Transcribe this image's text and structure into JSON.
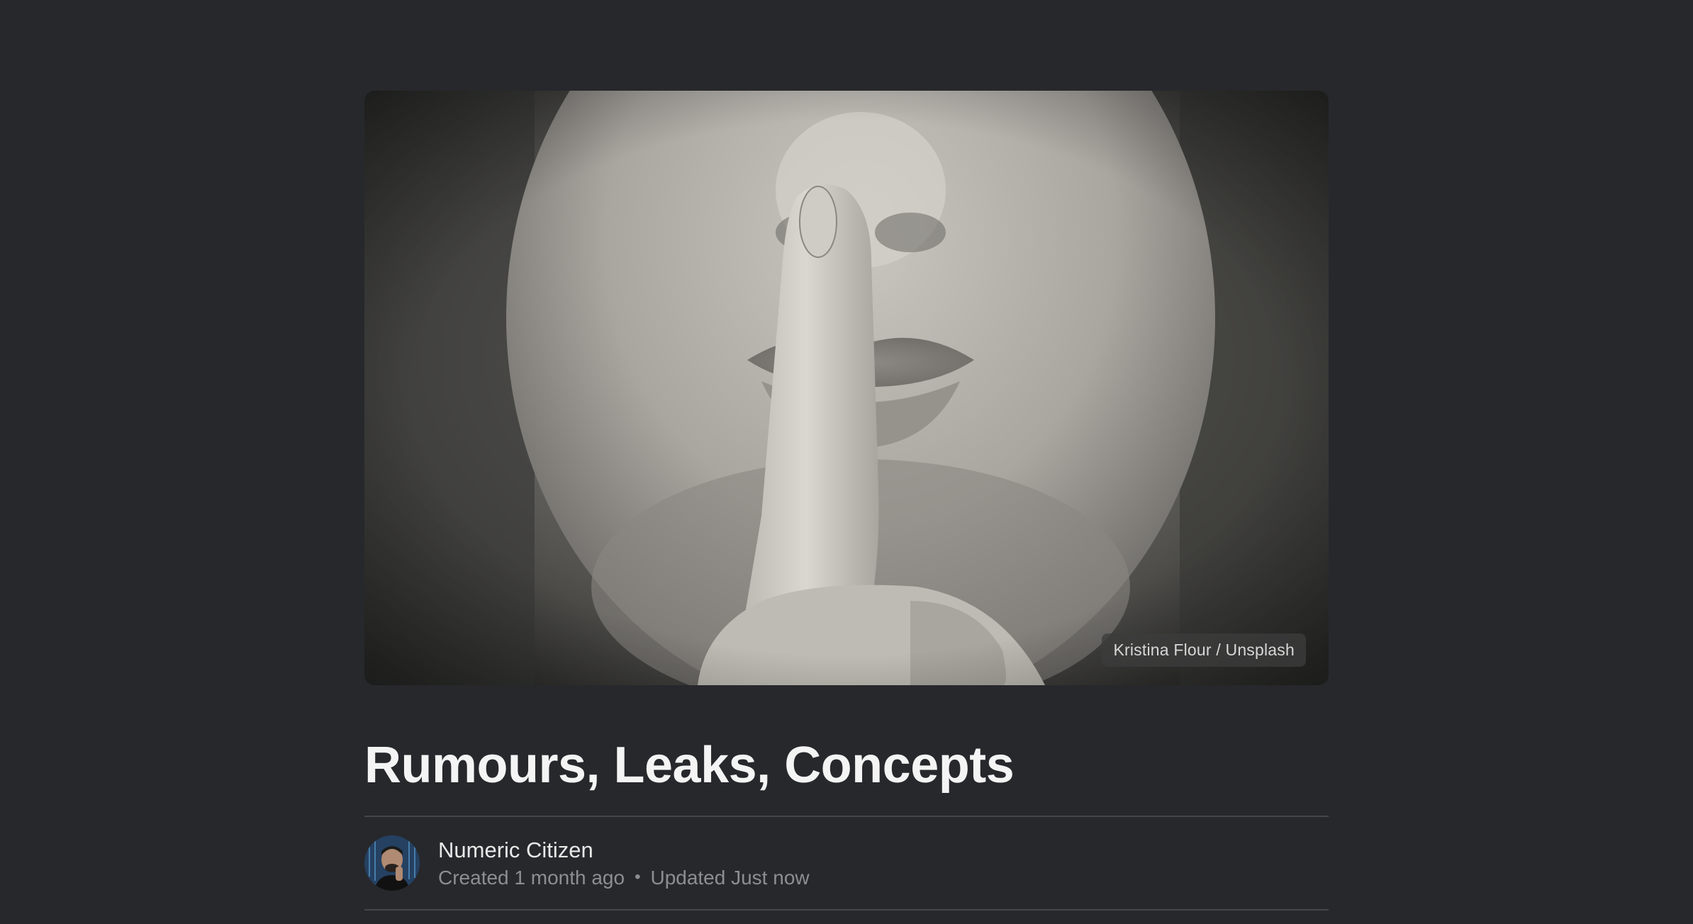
{
  "article": {
    "image_credit": "Kristina Flour / Unsplash",
    "title": "Rumours, Leaks, Concepts",
    "author": "Numeric Citizen",
    "created": "Created 1 month ago",
    "separator": "•",
    "updated": "Updated Just now"
  },
  "icons": {
    "feature_image": "shush-photo",
    "avatar": "author-avatar"
  },
  "colors": {
    "background": "#27282c",
    "title": "#f4f4f4",
    "muted": "#8d8e93",
    "divider": "#45464b"
  }
}
